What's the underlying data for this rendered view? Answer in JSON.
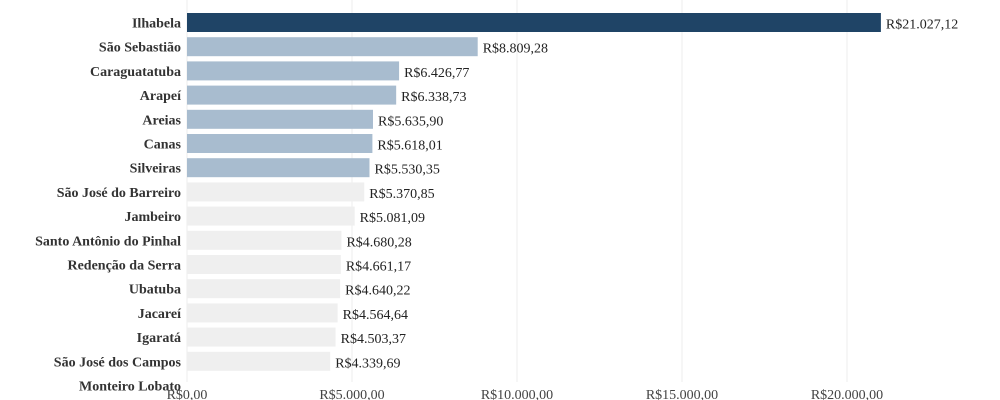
{
  "chart_data": {
    "type": "bar",
    "orientation": "horizontal",
    "categories": [
      "Ilhabela",
      "São Sebastião",
      "Caraguatatuba",
      "Arapeí",
      "Areias",
      "Canas",
      "Silveiras",
      "São José do Barreiro",
      "Jambeiro",
      "Santo Antônio do Pinhal",
      "Redenção da Serra",
      "Ubatuba",
      "Jacareí",
      "Igaratá",
      "São José dos Campos",
      "Monteiro Lobato"
    ],
    "values": [
      21027.12,
      8809.28,
      6426.77,
      6338.73,
      5635.9,
      5618.01,
      5530.35,
      5370.85,
      5081.09,
      4680.28,
      4661.17,
      4640.22,
      4564.64,
      4503.37,
      4339.69,
      null
    ],
    "value_labels": [
      "R$21.027,12",
      "R$8.809,28",
      "R$6.426,77",
      "R$6.338,73",
      "R$5.635,90",
      "R$5.618,01",
      "R$5.530,35",
      "R$5.370,85",
      "R$5.081,09",
      "R$4.680,28",
      "R$4.661,17",
      "R$4.640,22",
      "R$4.564,64",
      "R$4.503,37",
      "R$4.339,69",
      ""
    ],
    "xticks": [
      0,
      5000,
      10000,
      15000,
      20000
    ],
    "xtick_labels": [
      "R$0,00",
      "R$5.000,00",
      "R$10.000,00",
      "R$15.000,00",
      "R$20.000,00"
    ],
    "xlim": [
      0,
      24500
    ],
    "grid": true,
    "colors": {
      "highlight": "#1f4466",
      "secondary": "#a8bccf",
      "muted": "#efefef"
    },
    "color_groups": [
      "highlight",
      "secondary",
      "secondary",
      "secondary",
      "secondary",
      "secondary",
      "secondary",
      "muted",
      "muted",
      "muted",
      "muted",
      "muted",
      "muted",
      "muted",
      "muted",
      "muted"
    ]
  }
}
